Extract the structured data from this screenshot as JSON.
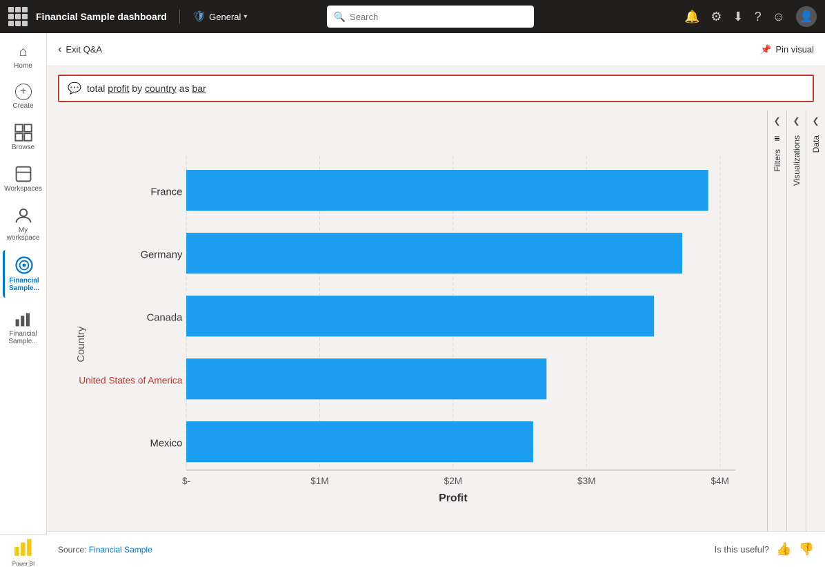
{
  "topnav": {
    "app_title": "Financial Sample  dashboard",
    "workspace_label": "General",
    "search_placeholder": "Search",
    "shield_label": "General"
  },
  "sidebar": {
    "items": [
      {
        "id": "home",
        "label": "Home",
        "icon": "⌂"
      },
      {
        "id": "create",
        "label": "Create",
        "icon": "+"
      },
      {
        "id": "browse",
        "label": "Browse",
        "icon": "⊞"
      },
      {
        "id": "workspaces",
        "label": "Workspaces",
        "icon": "⊡"
      },
      {
        "id": "my-workspace",
        "label": "My workspace",
        "icon": "👤"
      },
      {
        "id": "financial-sample",
        "label": "Financial Sample...",
        "icon": "◎",
        "active": true
      },
      {
        "id": "financial-sample2",
        "label": "Financial Sample...",
        "icon": "▦"
      }
    ],
    "more_label": "...",
    "powerbi_label": "Power BI"
  },
  "qa_header": {
    "exit_label": "Exit Q&A",
    "pin_label": "Pin visual"
  },
  "qa_input": {
    "query": "total profit by country as bar",
    "query_parts": [
      {
        "text": "total ",
        "underline": false
      },
      {
        "text": "profit",
        "underline": true
      },
      {
        "text": " by ",
        "underline": false
      },
      {
        "text": "country",
        "underline": true
      },
      {
        "text": " as ",
        "underline": false
      },
      {
        "text": "bar",
        "underline": true
      }
    ]
  },
  "chart": {
    "title": "total profit by country as bar",
    "y_axis_label": "Country",
    "x_axis_label": "Profit",
    "x_ticks": [
      "$-",
      "$1M",
      "$2M",
      "$3M",
      "$4M"
    ],
    "bars": [
      {
        "country": "France",
        "value": 3.9,
        "max": 4.0,
        "color": "#1b9ef0"
      },
      {
        "country": "Germany",
        "value": 3.6,
        "max": 4.0,
        "color": "#1b9ef0"
      },
      {
        "country": "Canada",
        "value": 3.35,
        "max": 4.0,
        "color": "#1b9ef0"
      },
      {
        "country": "United States of America",
        "value": 2.7,
        "max": 4.0,
        "color": "#1b9ef0",
        "label_color": "#c0392b"
      },
      {
        "country": "Mexico",
        "value": 2.6,
        "max": 4.0,
        "color": "#1b9ef0"
      }
    ]
  },
  "right_panels": [
    {
      "id": "filters",
      "label": "Filters",
      "icon": "≡"
    },
    {
      "id": "visualizations",
      "label": "Visualizations",
      "icon": ""
    },
    {
      "id": "data",
      "label": "Data",
      "icon": ""
    }
  ],
  "footer": {
    "source_prefix": "Source: ",
    "source_link": "Financial Sample",
    "feedback_label": "Is this useful?"
  }
}
